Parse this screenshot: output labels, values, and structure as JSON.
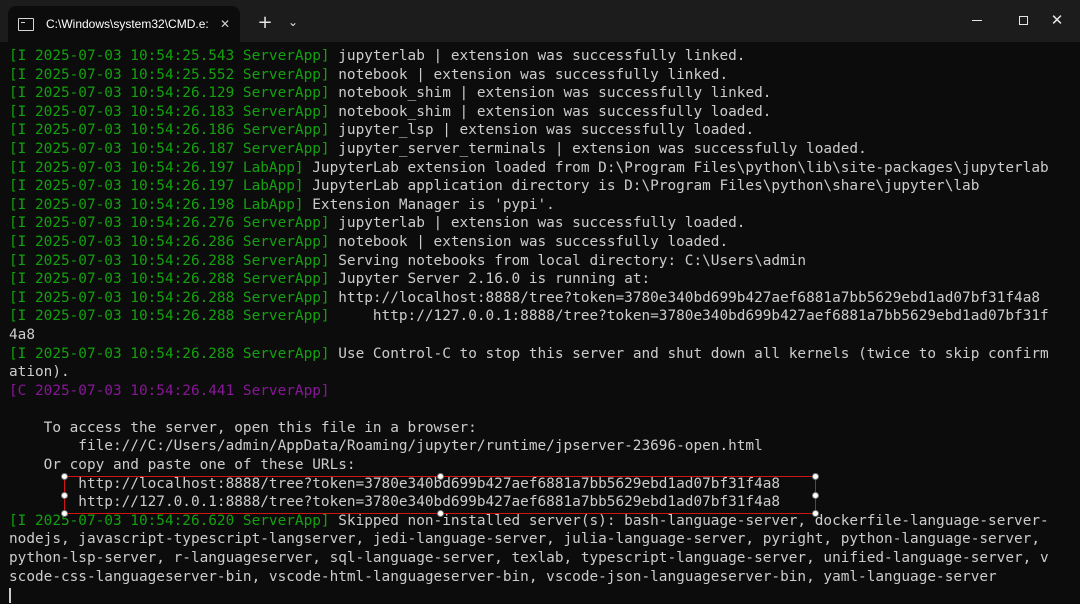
{
  "titlebar": {
    "tab_title": "C:\\Windows\\system32\\CMD.e:",
    "tab_close_glyph": "✕",
    "new_tab_glyph": "+",
    "dropdown_glyph": "⌄",
    "close_glyph": "✕"
  },
  "terminal": {
    "lines": [
      {
        "p": "[I 2025-07-03 10:54:25.543 ServerApp]",
        "t": " jupyterlab | extension was successfully linked."
      },
      {
        "p": "[I 2025-07-03 10:54:25.552 ServerApp]",
        "t": " notebook | extension was successfully linked."
      },
      {
        "p": "[I 2025-07-03 10:54:26.129 ServerApp]",
        "t": " notebook_shim | extension was successfully linked."
      },
      {
        "p": "[I 2025-07-03 10:54:26.183 ServerApp]",
        "t": " notebook_shim | extension was successfully loaded."
      },
      {
        "p": "[I 2025-07-03 10:54:26.186 ServerApp]",
        "t": " jupyter_lsp | extension was successfully loaded."
      },
      {
        "p": "[I 2025-07-03 10:54:26.187 ServerApp]",
        "t": " jupyter_server_terminals | extension was successfully loaded."
      },
      {
        "p": "[I 2025-07-03 10:54:26.197 LabApp]",
        "t": " JupyterLab extension loaded from D:\\Program Files\\python\\lib\\site-packages\\jupyterlab"
      },
      {
        "p": "[I 2025-07-03 10:54:26.197 LabApp]",
        "t": " JupyterLab application directory is D:\\Program Files\\python\\share\\jupyter\\lab"
      },
      {
        "p": "[I 2025-07-03 10:54:26.198 LabApp]",
        "t": " Extension Manager is 'pypi'."
      },
      {
        "p": "[I 2025-07-03 10:54:26.276 ServerApp]",
        "t": " jupyterlab | extension was successfully loaded."
      },
      {
        "p": "[I 2025-07-03 10:54:26.286 ServerApp]",
        "t": " notebook | extension was successfully loaded."
      },
      {
        "p": "[I 2025-07-03 10:54:26.288 ServerApp]",
        "t": " Serving notebooks from local directory: C:\\Users\\admin"
      },
      {
        "p": "[I 2025-07-03 10:54:26.288 ServerApp]",
        "t": " Jupyter Server 2.16.0 is running at:"
      },
      {
        "p": "[I 2025-07-03 10:54:26.288 ServerApp]",
        "t": " http://localhost:8888/tree?token=3780e340bd699b427aef6881a7bb5629ebd1ad07bf31f4a8"
      },
      {
        "p": "[I 2025-07-03 10:54:26.288 ServerApp]",
        "t": "     http://127.0.0.1:8888/tree?token=3780e340bd699b427aef6881a7bb5629ebd1ad07bf31f"
      },
      {
        "p": "",
        "t": "4a8"
      },
      {
        "p": "[I 2025-07-03 10:54:26.288 ServerApp]",
        "t": " Use Control-C to stop this server and shut down all kernels (twice to skip confirm"
      },
      {
        "p": "",
        "t": "ation)."
      },
      {
        "p": "[C 2025-07-03 10:54:26.441 ServerApp]",
        "t": "",
        "crit": true
      },
      {
        "p": "",
        "t": ""
      },
      {
        "p": "",
        "t": "    To access the server, open this file in a browser:"
      },
      {
        "p": "",
        "t": "        file:///C:/Users/admin/AppData/Roaming/jupyter/runtime/jpserver-23696-open.html"
      },
      {
        "p": "",
        "t": "    Or copy and paste one of these URLs:"
      },
      {
        "p": "",
        "t": "        http://localhost:8888/tree?token=3780e340bd699b427aef6881a7bb5629ebd1ad07bf31f4a8"
      },
      {
        "p": "",
        "t": "        http://127.0.0.1:8888/tree?token=3780e340bd699b427aef6881a7bb5629ebd1ad07bf31f4a8"
      },
      {
        "p": "[I 2025-07-03 10:54:26.620 ServerApp]",
        "t": " Skipped non-installed server(s): bash-language-server, dockerfile-language-server-"
      },
      {
        "p": "",
        "t": "nodejs, javascript-typescript-langserver, jedi-language-server, julia-language-server, pyright, python-language-server,"
      },
      {
        "p": "",
        "t": "python-lsp-server, r-languageserver, sql-language-server, texlab, typescript-language-server, unified-language-server, v"
      },
      {
        "p": "",
        "t": "scode-css-languageserver-bin, vscode-html-languageserver-bin, vscode-json-languageserver-bin, yaml-language-server"
      }
    ]
  }
}
